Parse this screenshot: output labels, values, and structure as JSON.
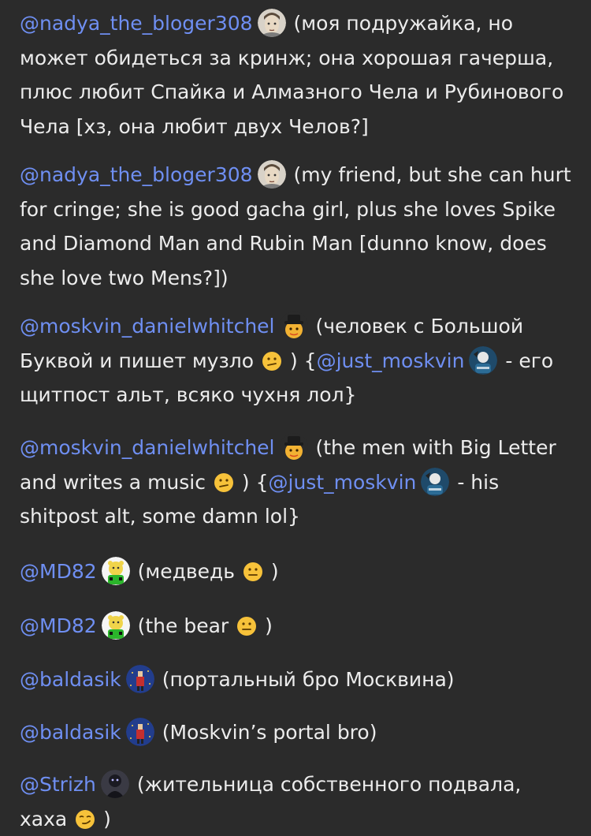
{
  "entries": [
    {
      "mention": "@nadya_the_bloger308",
      "avatar_icon": "portrait-avatar",
      "text": "(моя подружайка, но может обидеться за кринж; она хорошая гачерша, плюс любит Спайка и Алмазного Чела и Рубинового Чела [хз, она любит двух Челов?]"
    },
    {
      "mention": "@nadya_the_bloger308",
      "avatar_icon": "portrait-avatar",
      "text": "(my friend, but she can hurt for cringe; she is good gacha girl, plus she loves Spike and Diamond Man and Rubin Man [dunno know, does she love two Mens?])"
    },
    {
      "mention": "@moskvin_danielwhitchel",
      "avatar_icon": "hat-character-avatar",
      "text_before": "(человек с Большой Буквой и пишет музло",
      "emoji": "confused-face-emoji",
      "text_mid": ") {",
      "mention2": "@just_moskvin",
      "avatar2_icon": "dark-character-avatar",
      "text_after": "- его щитпост альт, всяко чухня лол}"
    },
    {
      "mention": "@moskvin_danielwhitchel",
      "avatar_icon": "hat-character-avatar",
      "text_before": "(the men with Big Letter and writes a music",
      "emoji": "confused-face-emoji",
      "text_mid": ") {",
      "mention2": "@just_moskvin",
      "avatar2_icon": "dark-character-avatar",
      "text_after": "- his shitpost alt, some damn lol}"
    },
    {
      "mention": "@MD82",
      "avatar_icon": "green-bear-avatar",
      "text_before": "(медведь",
      "emoji": "neutral-face-emoji",
      "text_after": ")"
    },
    {
      "mention": "@MD82",
      "avatar_icon": "green-bear-avatar",
      "text_before": "(the bear",
      "emoji": "neutral-face-emoji",
      "text_after": ")"
    },
    {
      "mention": "@baldasik",
      "avatar_icon": "blue-portal-avatar",
      "text": "(портальный бро Москвина)"
    },
    {
      "mention": "@baldasik",
      "avatar_icon": "blue-portal-avatar",
      "text": "(Moskvin’s portal bro)"
    },
    {
      "mention": "@Strizh",
      "avatar_icon": "dark-figure-avatar",
      "text_before": "(жительница собственного подвала, хаха",
      "emoji": "smirking-face-emoji",
      "text_after": ")"
    }
  ],
  "colors": {
    "background": "#2b2b2b",
    "text": "#ececec",
    "mention": "#6f8ff2"
  }
}
